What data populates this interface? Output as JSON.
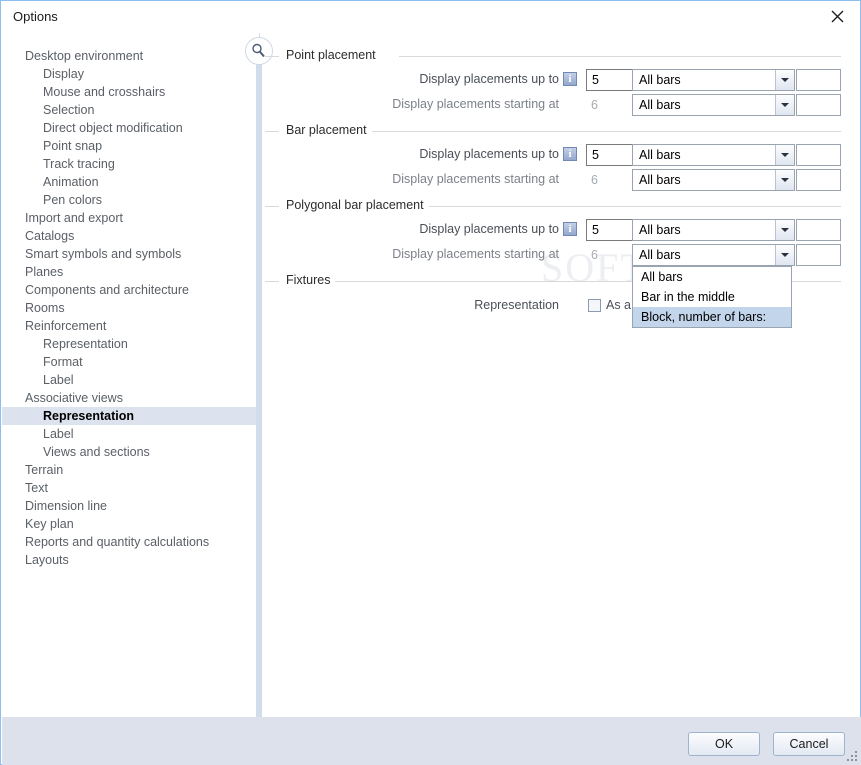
{
  "window": {
    "title": "Options",
    "close_icon": "close-icon"
  },
  "sidebar": {
    "items": [
      {
        "label": "Desktop environment",
        "level": 0,
        "selected": false
      },
      {
        "label": "Display",
        "level": 1,
        "selected": false
      },
      {
        "label": "Mouse and crosshairs",
        "level": 1,
        "selected": false
      },
      {
        "label": "Selection",
        "level": 1,
        "selected": false
      },
      {
        "label": "Direct object modification",
        "level": 1,
        "selected": false
      },
      {
        "label": "Point snap",
        "level": 1,
        "selected": false
      },
      {
        "label": "Track tracing",
        "level": 1,
        "selected": false
      },
      {
        "label": "Animation",
        "level": 1,
        "selected": false
      },
      {
        "label": "Pen colors",
        "level": 1,
        "selected": false
      },
      {
        "label": "Import and export",
        "level": 0,
        "selected": false
      },
      {
        "label": "Catalogs",
        "level": 0,
        "selected": false
      },
      {
        "label": "Smart symbols and symbols",
        "level": 0,
        "selected": false
      },
      {
        "label": "Planes",
        "level": 0,
        "selected": false
      },
      {
        "label": "Components and architecture",
        "level": 0,
        "selected": false
      },
      {
        "label": "Rooms",
        "level": 0,
        "selected": false
      },
      {
        "label": "Reinforcement",
        "level": 0,
        "selected": false
      },
      {
        "label": "Representation",
        "level": 1,
        "selected": false
      },
      {
        "label": "Format",
        "level": 1,
        "selected": false
      },
      {
        "label": "Label",
        "level": 1,
        "selected": false
      },
      {
        "label": "Associative views",
        "level": 0,
        "selected": false
      },
      {
        "label": "Representation",
        "level": 1,
        "selected": true
      },
      {
        "label": "Label",
        "level": 1,
        "selected": false
      },
      {
        "label": "Views and sections",
        "level": 1,
        "selected": false
      },
      {
        "label": "Terrain",
        "level": 0,
        "selected": false
      },
      {
        "label": "Text",
        "level": 0,
        "selected": false
      },
      {
        "label": "Dimension line",
        "level": 0,
        "selected": false
      },
      {
        "label": "Key plan",
        "level": 0,
        "selected": false
      },
      {
        "label": "Reports and quantity calculations",
        "level": 0,
        "selected": false
      },
      {
        "label": "Layouts",
        "level": 0,
        "selected": false
      }
    ],
    "info_icon": "info-icon"
  },
  "content": {
    "search_icon": "magnifier-icon",
    "groups": {
      "point_placement": {
        "title": "Point placement",
        "row_up_to": {
          "label": "Display placements up to",
          "info_icon": "info-icon",
          "value": "5",
          "combo_value": "All bars",
          "extra_value": ""
        },
        "row_starting_at": {
          "label": "Display placements starting at",
          "value": "6",
          "combo_value": "All bars",
          "extra_value": ""
        }
      },
      "bar_placement": {
        "title": "Bar placement",
        "row_up_to": {
          "label": "Display placements up to",
          "info_icon": "info-icon",
          "value": "5",
          "combo_value": "All bars",
          "extra_value": ""
        },
        "row_starting_at": {
          "label": "Display placements starting at",
          "value": "6",
          "combo_value": "All bars",
          "extra_value": ""
        }
      },
      "polygonal_bar_placement": {
        "title": "Polygonal bar placement",
        "row_up_to": {
          "label": "Display placements up to",
          "info_icon": "info-icon",
          "value": "5",
          "combo_value": "All bars",
          "extra_value": ""
        },
        "row_starting_at": {
          "label": "Display placements starting at",
          "value": "6",
          "combo_value": "All bars",
          "extra_value": ""
        }
      },
      "fixtures": {
        "title": "Fixtures",
        "representation_label": "Representation",
        "checkbox_label": "As a",
        "checkbox_checked": false
      }
    },
    "dropdown": {
      "open": true,
      "options": [
        {
          "label": "All bars",
          "highlighted": false
        },
        {
          "label": "Bar in the middle",
          "highlighted": false
        },
        {
          "label": "Block, number of bars:",
          "highlighted": true
        }
      ]
    },
    "watermark": "SOFTPEDIA"
  },
  "footer": {
    "ok_label": "OK",
    "cancel_label": "Cancel"
  },
  "colors": {
    "window_border": "#8ebdf0",
    "footer_bg": "#dce1ec",
    "selection_bg": "#dce3ef",
    "dropdown_highlight": "#c3d5ea",
    "rail": "#d3dcea"
  }
}
